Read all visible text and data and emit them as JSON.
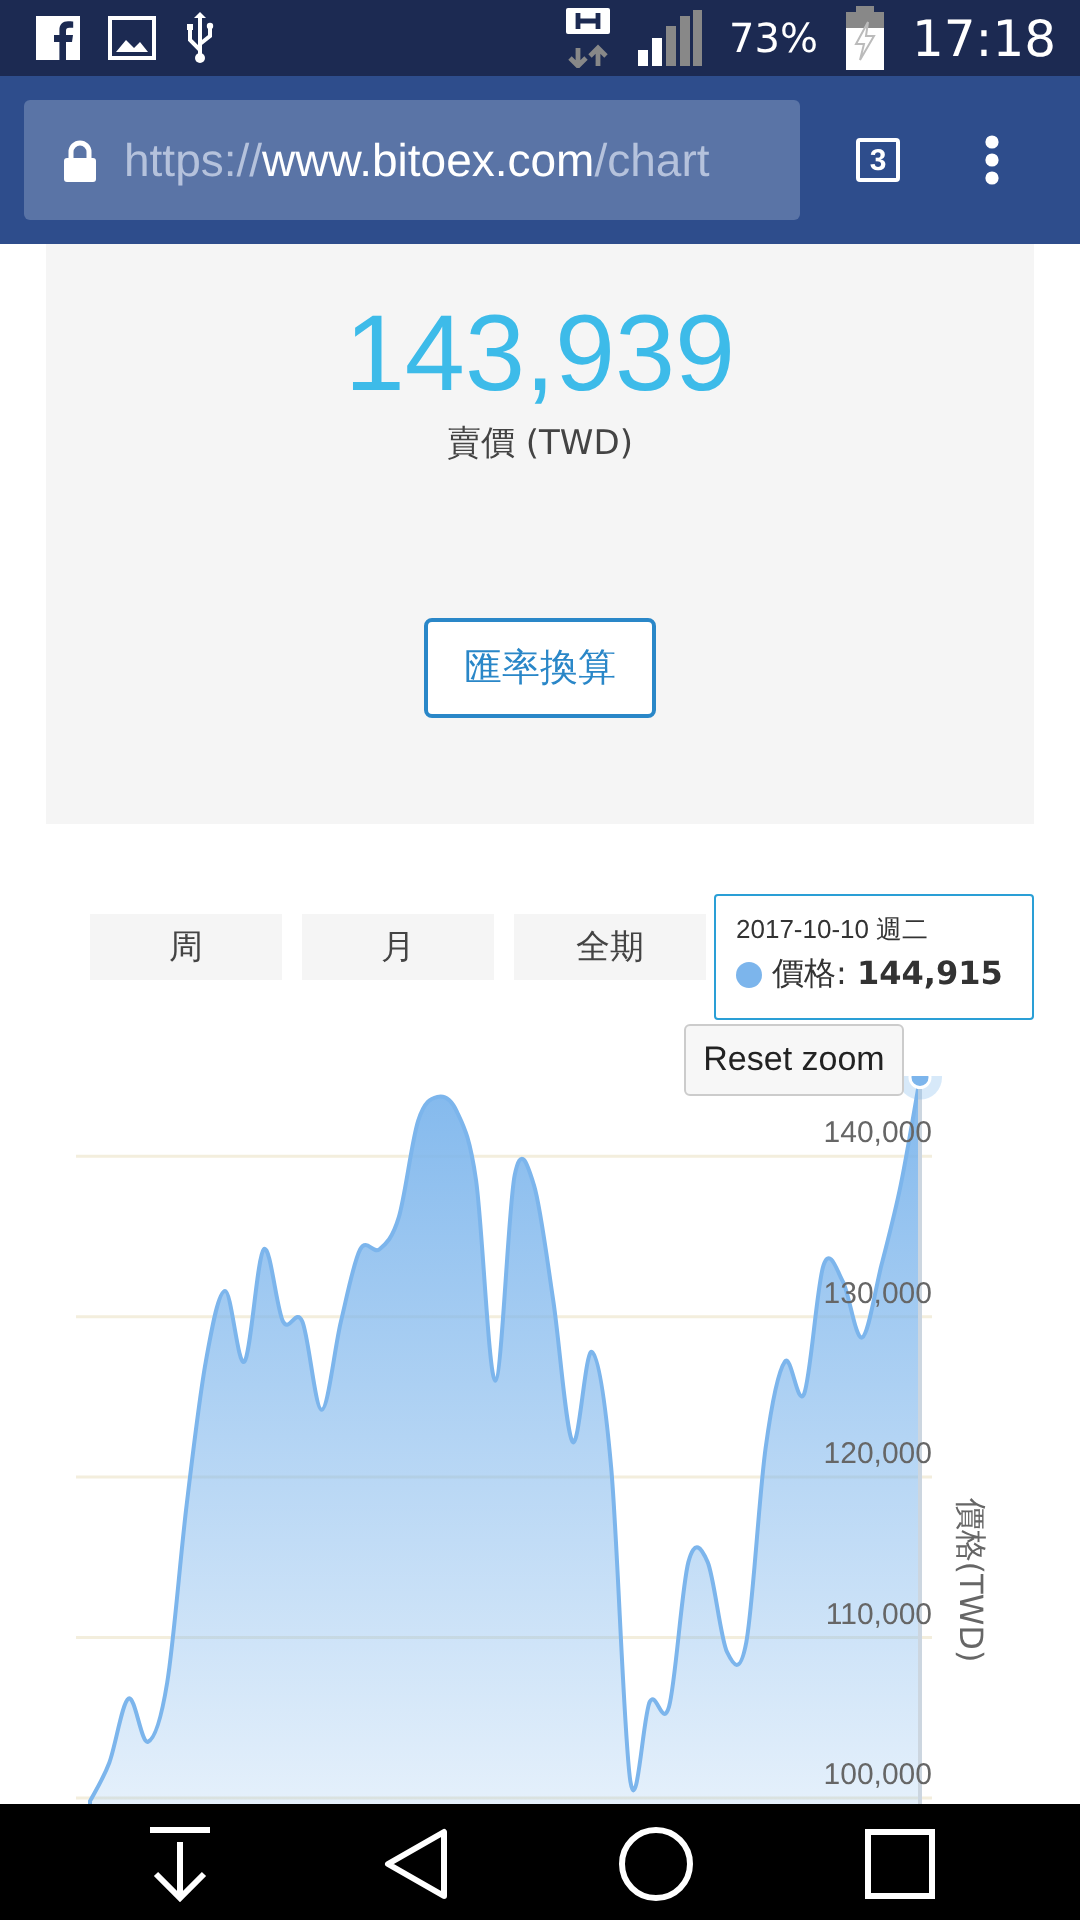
{
  "status_bar": {
    "battery": "73%",
    "time": "17:18"
  },
  "browser": {
    "url": {
      "scheme": "https://",
      "host": "www.bitoex.com",
      "path": "/chart"
    },
    "tab_count": "3"
  },
  "price_card": {
    "price": "143,939",
    "caption": "賣價 (TWD)",
    "button": "匯率換算"
  },
  "range_buttons": [
    "周",
    "月",
    "全期"
  ],
  "chart": {
    "chart_data": {
      "type": "area",
      "ylabel": "價格(TWD)",
      "grid": true,
      "ylim": [
        99500,
        145000
      ],
      "yticks": [
        {
          "value": 100000,
          "label": "100,000"
        },
        {
          "value": 110000,
          "label": "110,000"
        },
        {
          "value": 120000,
          "label": "120,000"
        },
        {
          "value": 130000,
          "label": "130,000"
        },
        {
          "value": 140000,
          "label": "140,000"
        }
      ],
      "series": [
        {
          "color": "#7cb5ec",
          "values": [
            99800,
            102200,
            106200,
            103500,
            107200,
            118200,
            127200,
            131600,
            127200,
            134200,
            129700,
            129700,
            124200,
            129700,
            134200,
            134200,
            136200,
            142200,
            143700,
            142800,
            138500,
            126000,
            138800,
            138200,
            131000,
            122200,
            127800,
            120600,
            101000,
            106000,
            105700,
            114700,
            114700,
            109100,
            109700,
            121800,
            127200,
            125200,
            133200,
            132200,
            128700,
            133200,
            138200,
            144900
          ]
        }
      ]
    },
    "tooltip": {
      "date": "2017-10-10 週二",
      "label": "價格:",
      "value": "144,915"
    },
    "reset_button": "Reset zoom"
  }
}
